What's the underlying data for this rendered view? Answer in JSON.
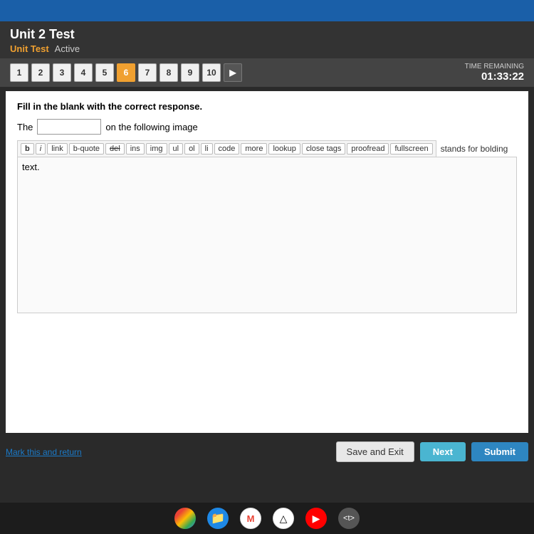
{
  "topBar": {},
  "header": {
    "title": "Unit 2 Test",
    "subtitle_unit": "Unit Test",
    "subtitle_status": "Active"
  },
  "nav": {
    "questions": [
      "1",
      "2",
      "3",
      "4",
      "5",
      "6",
      "7",
      "8",
      "9",
      "10"
    ],
    "activeQuestion": 6,
    "timer_label": "TIME REMAINING",
    "timer_value": "01:33:22"
  },
  "question": {
    "instruction": "Fill in the blank with the correct response.",
    "fill_prefix": "The",
    "fill_suffix": "on the following image",
    "blank_value": "",
    "blank_placeholder": ""
  },
  "toolbar": {
    "buttons": [
      "b",
      "i",
      "link",
      "b-quote",
      "del",
      "ins",
      "img",
      "ul",
      "ol",
      "li",
      "code",
      "more",
      "lookup",
      "close tags",
      "proofread",
      "fullscreen"
    ],
    "stands_for_text": "stands for bolding"
  },
  "editor": {
    "content": "text."
  },
  "actions": {
    "mark_return": "Mark this and return",
    "save_exit": "Save and Exit",
    "next": "Next",
    "submit": "Submit"
  },
  "taskbar": {
    "icons": [
      "chrome",
      "files",
      "gmail",
      "drive",
      "youtube",
      "code"
    ]
  }
}
